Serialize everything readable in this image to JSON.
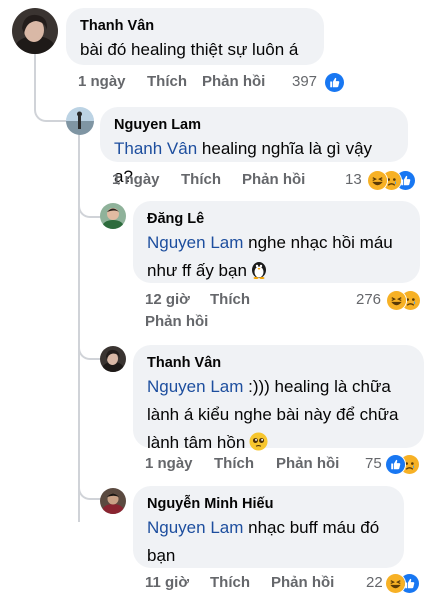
{
  "colors": {
    "bubble": "#f0f2f5",
    "mention": "#1d4e9e",
    "meta": "#65676b",
    "like": "#1877f2",
    "haha": "#f7b125"
  },
  "comments": [
    {
      "author": "Thanh Vân",
      "text": "bài đó healing thiệt sự luôn á",
      "time": "1 ngày",
      "like_label": "Thích",
      "reply_label": "Phản hồi",
      "reaction_count": "397",
      "reaction_icons": [
        "like-icon"
      ]
    },
    {
      "author": "Nguyen Lam",
      "mention": "Thanh Vân",
      "text": " healing nghĩa là gì vậy ạ?",
      "time": "1 ngày",
      "like_label": "Thích",
      "reply_label": "Phản hồi",
      "reaction_count": "13",
      "reaction_icons": [
        "haha-icon",
        "sad-icon",
        "like-icon"
      ]
    },
    {
      "author": "Đăng Lê",
      "mention": "Nguyen Lam",
      "text_line1": " nghe nhạc hồi máu",
      "text_line2": "như ff ấy bạn",
      "text_emoji": "penguin-icon",
      "time": "12 giờ",
      "like_label": "Thích",
      "reply_label": "Phản hồi",
      "reaction_count": "276",
      "reaction_icons": [
        "haha-icon",
        "sad-icon"
      ]
    },
    {
      "author": "Thanh Vân",
      "mention": "Nguyen Lam",
      "text_line1": " :))) healing là chữa",
      "text_line2": "lành á kiểu nghe bài này để chữa",
      "text_line3": "lành tâm hồn",
      "text_emoji": "pleading-face-icon",
      "time": "1 ngày",
      "like_label": "Thích",
      "reply_label": "Phản hồi",
      "reaction_count": "75",
      "reaction_icons": [
        "like-icon",
        "sad-icon"
      ]
    },
    {
      "author": "Nguyễn Minh Hiếu",
      "mention": "Nguyen Lam",
      "text_line1": " nhạc buff máu đó",
      "text_line2": "bạn",
      "time": "11 giờ",
      "like_label": "Thích",
      "reply_label": "Phản hồi",
      "reaction_count": "22",
      "reaction_icons": [
        "haha-icon",
        "like-icon"
      ]
    }
  ]
}
